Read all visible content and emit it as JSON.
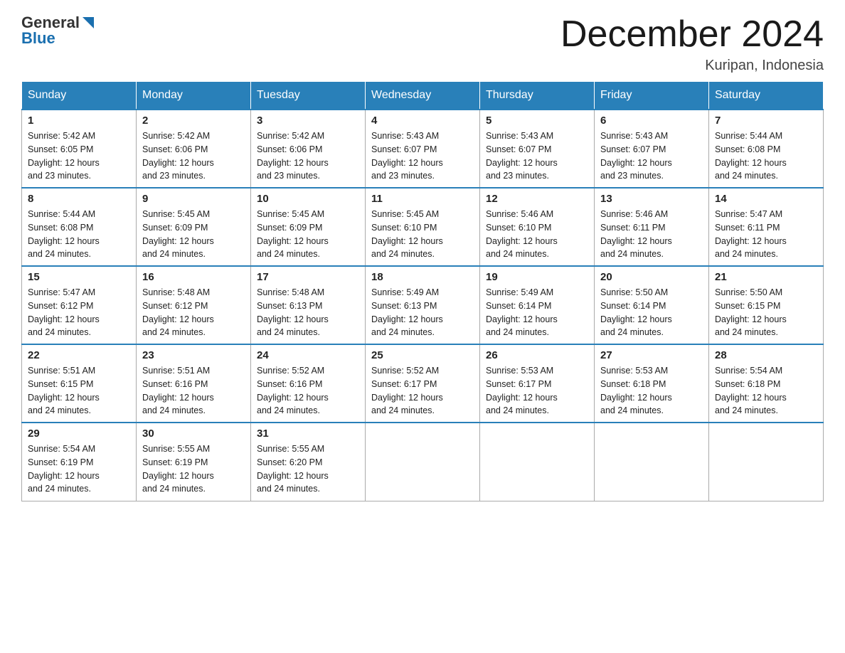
{
  "header": {
    "logo_text_normal": "General",
    "logo_text_blue": "Blue",
    "month_title": "December 2024",
    "location": "Kuripan, Indonesia"
  },
  "days_of_week": [
    "Sunday",
    "Monday",
    "Tuesday",
    "Wednesday",
    "Thursday",
    "Friday",
    "Saturday"
  ],
  "weeks": [
    [
      {
        "day": "1",
        "sunrise": "5:42 AM",
        "sunset": "6:05 PM",
        "daylight": "12 hours and 23 minutes."
      },
      {
        "day": "2",
        "sunrise": "5:42 AM",
        "sunset": "6:06 PM",
        "daylight": "12 hours and 23 minutes."
      },
      {
        "day": "3",
        "sunrise": "5:42 AM",
        "sunset": "6:06 PM",
        "daylight": "12 hours and 23 minutes."
      },
      {
        "day": "4",
        "sunrise": "5:43 AM",
        "sunset": "6:07 PM",
        "daylight": "12 hours and 23 minutes."
      },
      {
        "day": "5",
        "sunrise": "5:43 AM",
        "sunset": "6:07 PM",
        "daylight": "12 hours and 23 minutes."
      },
      {
        "day": "6",
        "sunrise": "5:43 AM",
        "sunset": "6:07 PM",
        "daylight": "12 hours and 23 minutes."
      },
      {
        "day": "7",
        "sunrise": "5:44 AM",
        "sunset": "6:08 PM",
        "daylight": "12 hours and 24 minutes."
      }
    ],
    [
      {
        "day": "8",
        "sunrise": "5:44 AM",
        "sunset": "6:08 PM",
        "daylight": "12 hours and 24 minutes."
      },
      {
        "day": "9",
        "sunrise": "5:45 AM",
        "sunset": "6:09 PM",
        "daylight": "12 hours and 24 minutes."
      },
      {
        "day": "10",
        "sunrise": "5:45 AM",
        "sunset": "6:09 PM",
        "daylight": "12 hours and 24 minutes."
      },
      {
        "day": "11",
        "sunrise": "5:45 AM",
        "sunset": "6:10 PM",
        "daylight": "12 hours and 24 minutes."
      },
      {
        "day": "12",
        "sunrise": "5:46 AM",
        "sunset": "6:10 PM",
        "daylight": "12 hours and 24 minutes."
      },
      {
        "day": "13",
        "sunrise": "5:46 AM",
        "sunset": "6:11 PM",
        "daylight": "12 hours and 24 minutes."
      },
      {
        "day": "14",
        "sunrise": "5:47 AM",
        "sunset": "6:11 PM",
        "daylight": "12 hours and 24 minutes."
      }
    ],
    [
      {
        "day": "15",
        "sunrise": "5:47 AM",
        "sunset": "6:12 PM",
        "daylight": "12 hours and 24 minutes."
      },
      {
        "day": "16",
        "sunrise": "5:48 AM",
        "sunset": "6:12 PM",
        "daylight": "12 hours and 24 minutes."
      },
      {
        "day": "17",
        "sunrise": "5:48 AM",
        "sunset": "6:13 PM",
        "daylight": "12 hours and 24 minutes."
      },
      {
        "day": "18",
        "sunrise": "5:49 AM",
        "sunset": "6:13 PM",
        "daylight": "12 hours and 24 minutes."
      },
      {
        "day": "19",
        "sunrise": "5:49 AM",
        "sunset": "6:14 PM",
        "daylight": "12 hours and 24 minutes."
      },
      {
        "day": "20",
        "sunrise": "5:50 AM",
        "sunset": "6:14 PM",
        "daylight": "12 hours and 24 minutes."
      },
      {
        "day": "21",
        "sunrise": "5:50 AM",
        "sunset": "6:15 PM",
        "daylight": "12 hours and 24 minutes."
      }
    ],
    [
      {
        "day": "22",
        "sunrise": "5:51 AM",
        "sunset": "6:15 PM",
        "daylight": "12 hours and 24 minutes."
      },
      {
        "day": "23",
        "sunrise": "5:51 AM",
        "sunset": "6:16 PM",
        "daylight": "12 hours and 24 minutes."
      },
      {
        "day": "24",
        "sunrise": "5:52 AM",
        "sunset": "6:16 PM",
        "daylight": "12 hours and 24 minutes."
      },
      {
        "day": "25",
        "sunrise": "5:52 AM",
        "sunset": "6:17 PM",
        "daylight": "12 hours and 24 minutes."
      },
      {
        "day": "26",
        "sunrise": "5:53 AM",
        "sunset": "6:17 PM",
        "daylight": "12 hours and 24 minutes."
      },
      {
        "day": "27",
        "sunrise": "5:53 AM",
        "sunset": "6:18 PM",
        "daylight": "12 hours and 24 minutes."
      },
      {
        "day": "28",
        "sunrise": "5:54 AM",
        "sunset": "6:18 PM",
        "daylight": "12 hours and 24 minutes."
      }
    ],
    [
      {
        "day": "29",
        "sunrise": "5:54 AM",
        "sunset": "6:19 PM",
        "daylight": "12 hours and 24 minutes."
      },
      {
        "day": "30",
        "sunrise": "5:55 AM",
        "sunset": "6:19 PM",
        "daylight": "12 hours and 24 minutes."
      },
      {
        "day": "31",
        "sunrise": "5:55 AM",
        "sunset": "6:20 PM",
        "daylight": "12 hours and 24 minutes."
      },
      null,
      null,
      null,
      null
    ]
  ],
  "labels": {
    "sunrise": "Sunrise:",
    "sunset": "Sunset:",
    "daylight": "Daylight:"
  }
}
